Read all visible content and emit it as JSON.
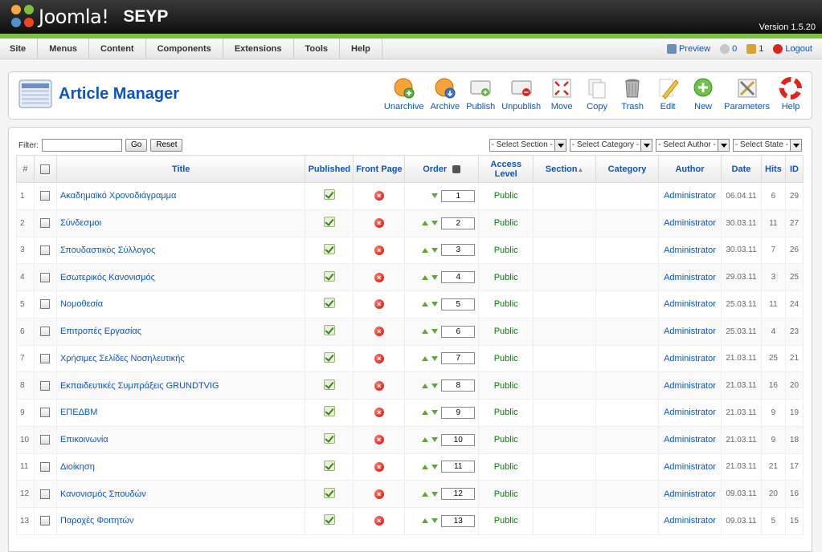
{
  "header": {
    "logo_text": "Joomla!",
    "site_name": "SEYP",
    "version": "Version 1.5.20"
  },
  "menu": [
    "Site",
    "Menus",
    "Content",
    "Components",
    "Extensions",
    "Tools",
    "Help"
  ],
  "status": {
    "preview": "Preview",
    "messages": "0",
    "users": "1",
    "logout": "Logout"
  },
  "toolbar": {
    "title": "Article Manager",
    "buttons": [
      "Unarchive",
      "Archive",
      "Publish",
      "Unpublish",
      "Move",
      "Copy",
      "Trash",
      "Edit",
      "New",
      "Parameters",
      "Help"
    ]
  },
  "filter": {
    "label": "Filter:",
    "go": "Go",
    "reset": "Reset"
  },
  "selects": [
    "- Select Section -",
    "- Select Category -",
    "- Select Author -",
    "- Select State -"
  ],
  "columns": {
    "num": "#",
    "title": "Title",
    "published": "Published",
    "front": "Front Page",
    "order": "Order",
    "access": "Access Level",
    "section": "Section",
    "category": "Category",
    "author": "Author",
    "date": "Date",
    "hits": "Hits",
    "id": "ID"
  },
  "rows": [
    {
      "n": "1",
      "title": "Ακαδημαϊκό Χρονοδιάγραμμα",
      "order": "1",
      "access": "Public",
      "author": "Administrator",
      "date": "06.04.11",
      "hits": "6",
      "id": "29"
    },
    {
      "n": "2",
      "title": "Σύνδεσμοι",
      "order": "2",
      "access": "Public",
      "author": "Administrator",
      "date": "30.03.11",
      "hits": "11",
      "id": "27"
    },
    {
      "n": "3",
      "title": "Σπουδαστικός Σύλλογος",
      "order": "3",
      "access": "Public",
      "author": "Administrator",
      "date": "30.03.11",
      "hits": "7",
      "id": "26"
    },
    {
      "n": "4",
      "title": "Εσωτερικός Κανονισμός",
      "order": "4",
      "access": "Public",
      "author": "Administrator",
      "date": "29.03.11",
      "hits": "3",
      "id": "25"
    },
    {
      "n": "5",
      "title": "Νομοθεσία",
      "order": "5",
      "access": "Public",
      "author": "Administrator",
      "date": "25.03.11",
      "hits": "11",
      "id": "24"
    },
    {
      "n": "6",
      "title": "Επιτροπές Εργασίας",
      "order": "6",
      "access": "Public",
      "author": "Administrator",
      "date": "25.03.11",
      "hits": "4",
      "id": "23"
    },
    {
      "n": "7",
      "title": "Χρήσιμες Σελίδες Νοσηλευτικής",
      "order": "7",
      "access": "Public",
      "author": "Administrator",
      "date": "21.03.11",
      "hits": "25",
      "id": "21"
    },
    {
      "n": "8",
      "title": "Εκπαιδευτικές Συμπράξεις GRUNDTVIG",
      "order": "8",
      "access": "Public",
      "author": "Administrator",
      "date": "21.03.11",
      "hits": "16",
      "id": "20"
    },
    {
      "n": "9",
      "title": "ΕΠΕΔΒΜ",
      "order": "9",
      "access": "Public",
      "author": "Administrator",
      "date": "21.03.11",
      "hits": "9",
      "id": "19"
    },
    {
      "n": "10",
      "title": "Επικοινωνία",
      "order": "10",
      "access": "Public",
      "author": "Administrator",
      "date": "21.03.11",
      "hits": "9",
      "id": "18"
    },
    {
      "n": "11",
      "title": "Διοίκηση",
      "order": "11",
      "access": "Public",
      "author": "Administrator",
      "date": "21.03.11",
      "hits": "21",
      "id": "17"
    },
    {
      "n": "12",
      "title": "Κανονισμός Σπουδών",
      "order": "12",
      "access": "Public",
      "author": "Administrator",
      "date": "09.03.11",
      "hits": "20",
      "id": "16"
    },
    {
      "n": "13",
      "title": "Παροχές Φοιτητών",
      "order": "13",
      "access": "Public",
      "author": "Administrator",
      "date": "09.03.11",
      "hits": "5",
      "id": "15"
    }
  ]
}
